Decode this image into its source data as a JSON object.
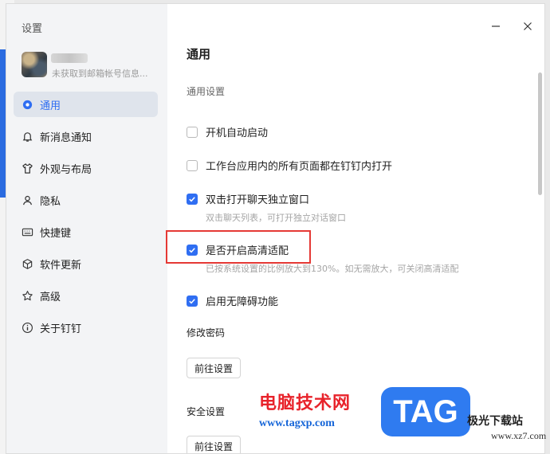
{
  "window": {
    "title": "设置"
  },
  "account": {
    "status": "未获取到邮箱帐号信息..."
  },
  "sidebar": {
    "items": [
      {
        "label": "通用",
        "icon": "gear-icon",
        "active": true
      },
      {
        "label": "新消息通知",
        "icon": "bell-icon"
      },
      {
        "label": "外观与布局",
        "icon": "shirt-icon"
      },
      {
        "label": "隐私",
        "icon": "person-icon"
      },
      {
        "label": "快捷键",
        "icon": "keyboard-icon"
      },
      {
        "label": "软件更新",
        "icon": "cube-icon"
      },
      {
        "label": "高级",
        "icon": "star-icon"
      },
      {
        "label": "关于钉钉",
        "icon": "info-icon"
      }
    ]
  },
  "main": {
    "title": "通用",
    "general_section": "通用设置",
    "options": [
      {
        "label": "开机自动启动",
        "checked": false
      },
      {
        "label": "工作台应用内的所有页面都在钉钉内打开",
        "checked": false
      },
      {
        "label": "双击打开聊天独立窗口",
        "checked": true,
        "hint": "双击聊天列表，可打开独立对话窗口"
      },
      {
        "label": "是否开启高清适配",
        "checked": true,
        "hint": "已按系统设置的比例放大到130%。如无需放大，可关闭高清适配"
      },
      {
        "label": "启用无障碍功能",
        "checked": true
      }
    ],
    "password_section": "修改密码",
    "password_button": "前往设置",
    "security_section": "安全设置",
    "security_button": "前往设置"
  },
  "watermark": {
    "cn": "电脑技术网",
    "url": "www.tagxp.com",
    "badge": "TAG",
    "site": "极光下载站",
    "site_url": "www.xz7.com"
  },
  "colors": {
    "accent": "#2f6ef2",
    "highlight": "#e53935"
  }
}
